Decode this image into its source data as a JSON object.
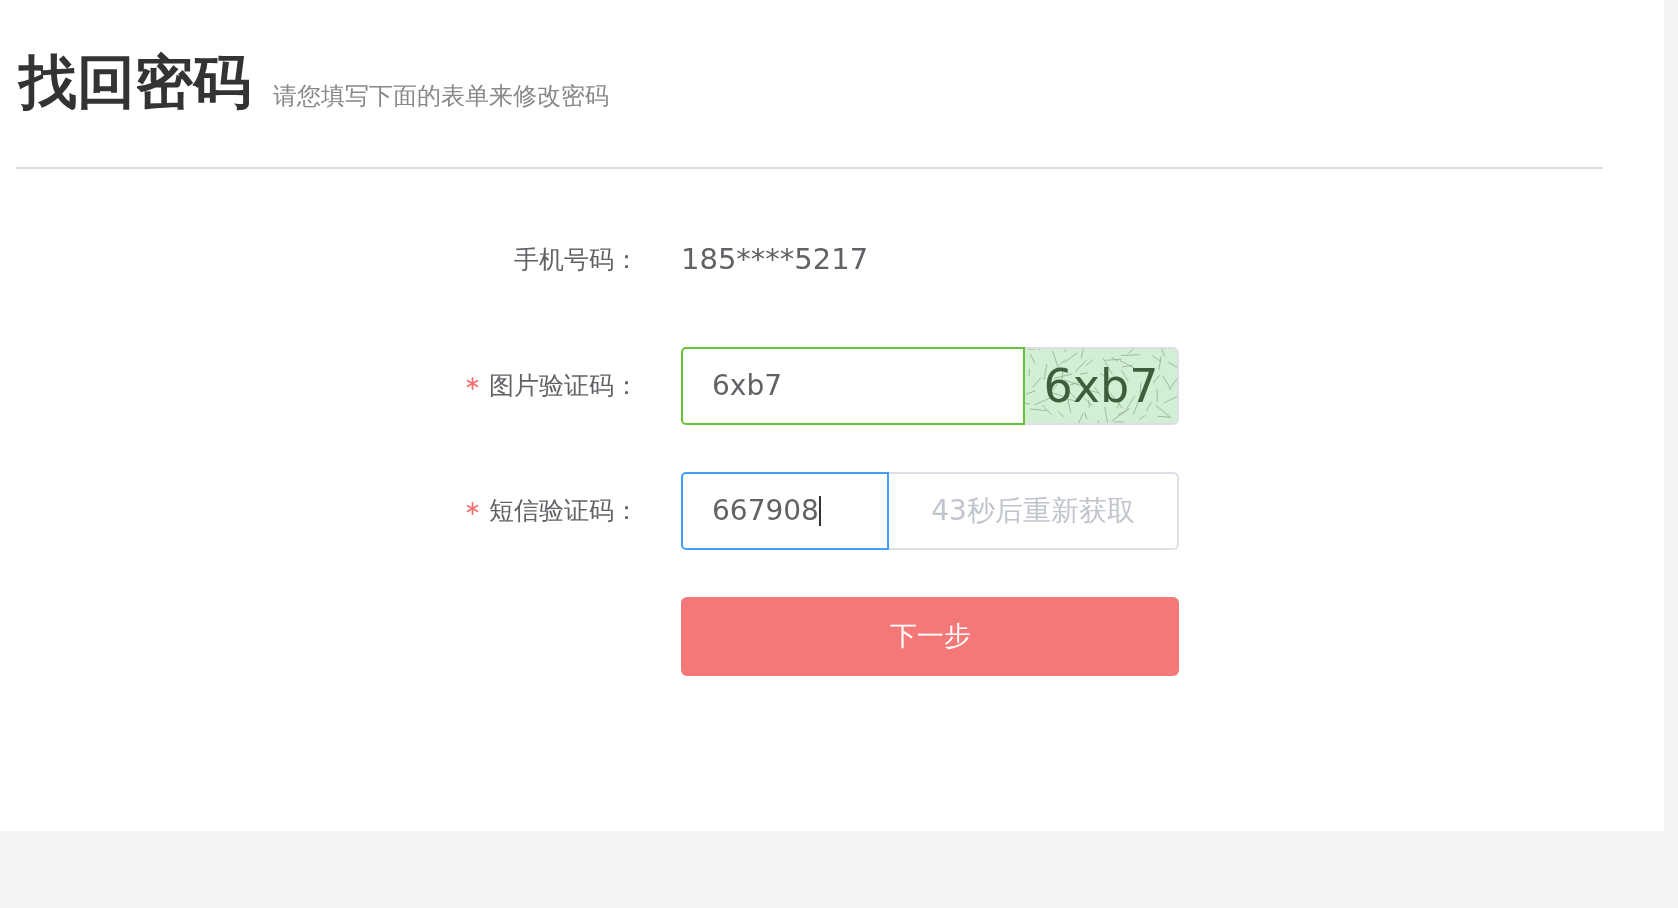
{
  "page": {
    "title": "找回密码",
    "subtitle": "请您填写下面的表单来修改密码"
  },
  "form": {
    "fields": [
      {
        "kind": "static",
        "label": "手机号码：",
        "required": false,
        "value": "185****5217"
      },
      {
        "kind": "captcha",
        "label": "图片验证码：",
        "required": true,
        "value": "6xb7",
        "valid": true,
        "focused": false,
        "captcha_text": "6xb7"
      },
      {
        "kind": "sms",
        "label": "短信验证码：",
        "required": true,
        "value": "667908",
        "focused": true,
        "resend_button": {
          "label": "43秒后重新获取",
          "disabled": true
        }
      }
    ],
    "submit_button": {
      "label": "下一步"
    }
  }
}
